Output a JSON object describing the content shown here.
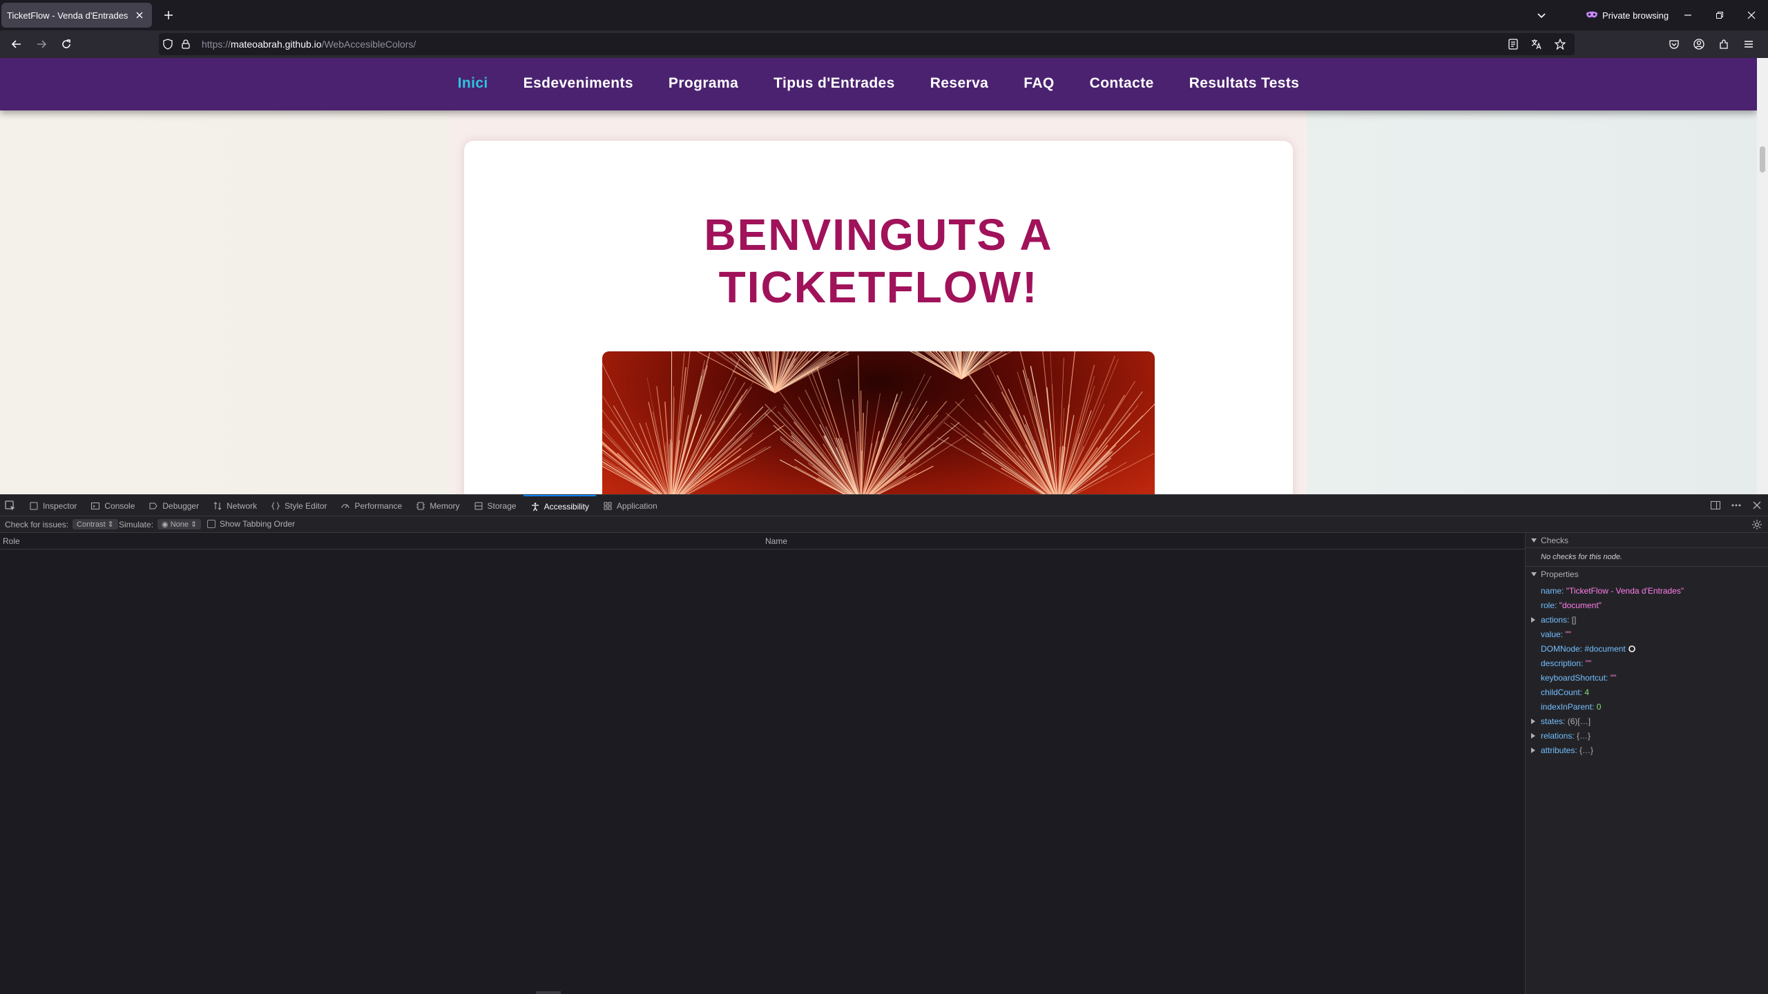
{
  "browser": {
    "tab_title": "TicketFlow - Venda d'Entrades",
    "private_label": "Private browsing",
    "url_prefix": "https://",
    "url_host": "mateoabrah.github.io",
    "url_path": "/WebAccesibleColors/"
  },
  "site": {
    "nav_items": [
      "Inici",
      "Esdeveniments",
      "Programa",
      "Tipus d'Entrades",
      "Reserva",
      "FAQ",
      "Contacte",
      "Resultats Tests"
    ],
    "hero_title": "BENVINGUTS A\nTICKETFLOW!"
  },
  "devtools": {
    "tabs": [
      "Inspector",
      "Console",
      "Debugger",
      "Network",
      "Style Editor",
      "Performance",
      "Memory",
      "Storage",
      "Accessibility",
      "Application"
    ],
    "active_tab": "Accessibility",
    "check_label": "Check for issues:",
    "check_value": "Contrast",
    "simulate_label": "Simulate:",
    "simulate_value": "None",
    "tabbing_label": "Show Tabbing Order",
    "col_role": "Role",
    "col_name": "Name",
    "checks_heading": "Checks",
    "no_checks": "No checks for this node.",
    "properties_heading": "Properties",
    "props": {
      "name_key": "name:",
      "name_val": "\"TicketFlow - Venda d'Entrades\"",
      "role_key": "role:",
      "role_val": "\"document\"",
      "actions_key": "actions:",
      "actions_val": "[]",
      "value_key": "value:",
      "value_val": "\"\"",
      "domnode_key": "DOMNode:",
      "domnode_val": "#document",
      "description_key": "description:",
      "description_val": "\"\"",
      "shortcut_key": "keyboardShortcut:",
      "shortcut_val": "\"\"",
      "childcount_key": "childCount:",
      "childcount_val": "4",
      "index_key": "indexInParent:",
      "index_val": "0",
      "states_key": "states:",
      "states_val": "(6)[…]",
      "relations_key": "relations:",
      "relations_val": "{…}",
      "attributes_key": "attributes:",
      "attributes_val": "{…}"
    }
  }
}
